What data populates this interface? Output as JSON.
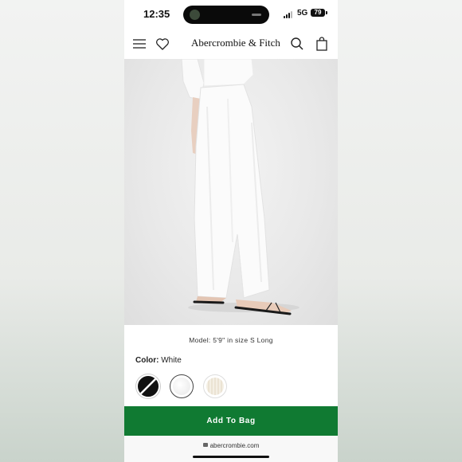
{
  "status_bar": {
    "time": "12:35",
    "network": "5G",
    "battery": "79"
  },
  "header": {
    "brand": "Abercrombie & Fitch",
    "menu_icon": "hamburger-icon",
    "wishlist_icon": "heart-icon",
    "search_icon": "search-icon",
    "bag_icon": "shopping-bag-icon"
  },
  "product": {
    "model_note": "Model: 5'9\" in size S Long",
    "color_label": "Color:",
    "color_value": "White",
    "swatches": [
      {
        "name": "Black",
        "color": "#111111"
      },
      {
        "name": "White",
        "color": "#ffffff",
        "selected": true
      },
      {
        "name": "Cream",
        "color": "#f1ebdf"
      }
    ]
  },
  "cta": {
    "add_to_bag": "Add To Bag",
    "color": "#107a32"
  },
  "browser": {
    "url": "abercrombie.com"
  }
}
